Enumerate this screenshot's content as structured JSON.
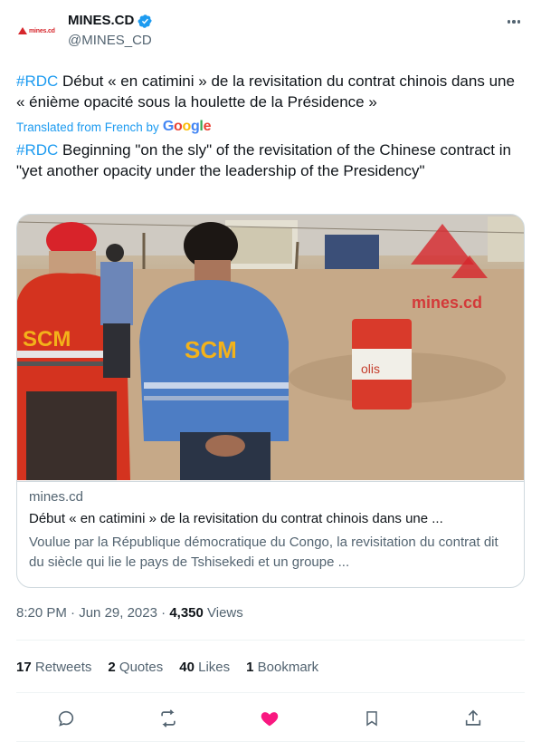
{
  "account": {
    "display_name": "MINES.CD",
    "handle": "@MINES_CD",
    "avatar_logo_text": "mines.cd"
  },
  "tweet": {
    "hashtag": "#RDC",
    "text": " Début « en catimini » de la revisitation du contrat chinois dans une « énième opacité sous la houlette de la Présidence »",
    "translated_label": "Translated from French by",
    "google_logo": "Google",
    "translation_hashtag": "#RDC",
    "translation_text": " Beginning \"on the sly\" of the revisitation of the Chinese contract in \"yet another opacity under the leadership of the Presidency\""
  },
  "card": {
    "watermark": "mines.cd",
    "jacket_logo_left": "SCM",
    "jacket_logo_right": "SCM",
    "barrel_text": "olis",
    "domain": "mines.cd",
    "title": "Début « en catimini » de la revisitation du contrat chinois dans une ...",
    "description": "Voulue par la République démocratique du Congo, la revisitation du contrat dit du siècle qui lie le pays de Tshisekedi et un groupe ..."
  },
  "meta": {
    "time": "8:20 PM",
    "sep1": " · ",
    "date": "Jun 29, 2023",
    "sep2": " · ",
    "views_count": "4,350",
    "views_label": " Views"
  },
  "stats": [
    {
      "count": "17",
      "label": " Retweets"
    },
    {
      "count": "2",
      "label": " Quotes"
    },
    {
      "count": "40",
      "label": " Likes"
    },
    {
      "count": "1",
      "label": " Bookmark"
    }
  ],
  "colors": {
    "accent": "#1d9bf0",
    "like": "#f91880",
    "text": "#0f1419",
    "muted": "#536471",
    "brand_red": "#d6262c"
  },
  "icons": {
    "verified": "verified-badge-icon",
    "more": "more-options-icon",
    "reply": "reply-icon",
    "retweet": "retweet-icon",
    "like": "like-heart-icon",
    "bookmark": "bookmark-icon",
    "share": "share-icon"
  }
}
